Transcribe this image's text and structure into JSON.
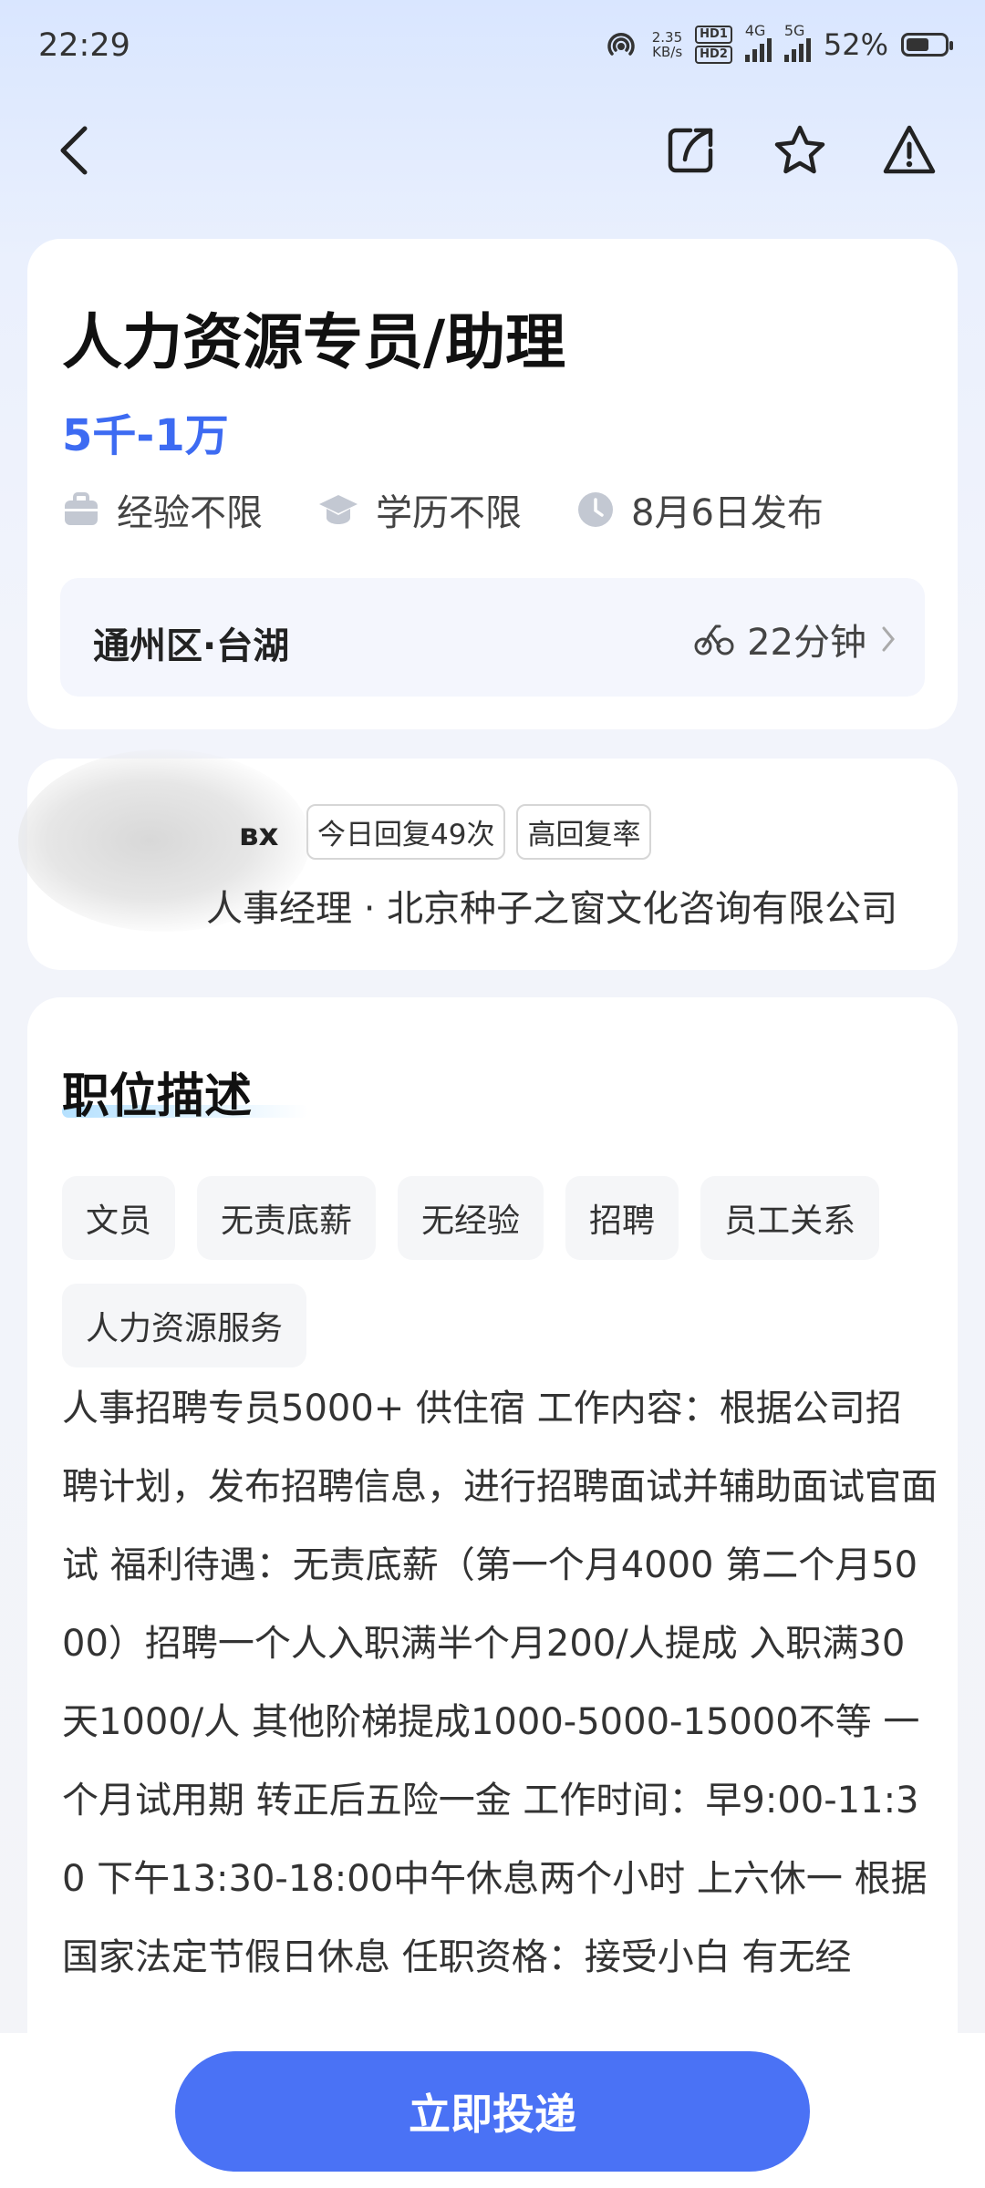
{
  "status_bar": {
    "time": "22:29",
    "net_speed_value": "2.35",
    "net_speed_unit": "KB/s",
    "hd1": "HD1",
    "hd2": "HD2",
    "sig1_label": "4G",
    "sig2_label": "5G",
    "battery": "52%"
  },
  "job": {
    "title": "人力资源专员/助理",
    "salary": "5千-1万",
    "experience": "经验不限",
    "education": "学历不限",
    "posted": "8月6日发布",
    "location": "通州区·台湖",
    "commute": "22分钟"
  },
  "recruiter": {
    "name_fragment": "вх",
    "badge_replies": "今日回复49次",
    "badge_rate": "高回复率",
    "title_company": "人事经理 · 北京种子之窗文化咨询有限公司"
  },
  "description": {
    "section_title": "职位描述",
    "tags": [
      "文员",
      "无责底薪",
      "无经验",
      "招聘",
      "员工关系",
      "人力资源服务"
    ],
    "text": "人事招聘专员5000+ 供住宿 工作内容：根据公司招聘计划，发布招聘信息，进行招聘面试并辅助面试官面试 福利待遇：无责底薪（第一个月4000 第二个月5000）招聘一个人入职满半个月200/人提成 入职满30天1000/人 其他阶梯提成1000-5000-15000不等 一个月试用期 转正后五险一金 工作时间：早9:00-11:30 下午13:30-18:00中午休息两个小时 上六休一 根据国家法定节假日休息 任职资格：接受小白 有无经"
  },
  "actions": {
    "apply": "立即投递"
  },
  "colors": {
    "accent": "#3d6bf2",
    "button": "#4a72f5"
  }
}
